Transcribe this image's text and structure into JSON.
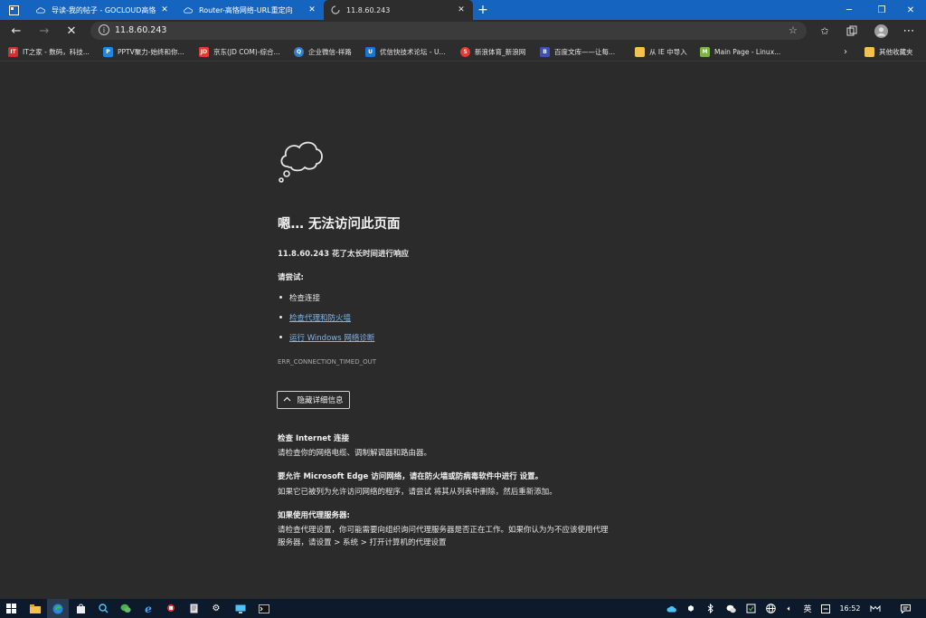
{
  "tabs": [
    {
      "label": "导读-我的帖子 - GOCLOUD高恪",
      "icon": "cloud-icon"
    },
    {
      "label": "Router-高恪网络-URL重定向",
      "icon": "cloud-icon"
    },
    {
      "label": "11.8.60.243",
      "icon": "loading-spinner-icon"
    }
  ],
  "new_tab_label": "+",
  "address": {
    "url": "11.8.60.243"
  },
  "bookmarks": [
    {
      "label": "IT之家 - 数码，科技...",
      "icon": "IT",
      "color": "#d32f2f"
    },
    {
      "label": "PPTV聚力-始终和你...",
      "icon": "P",
      "color": "#1e88e5"
    },
    {
      "label": "京东(JD COM)-综合...",
      "icon": "JD",
      "color": "#e53935"
    },
    {
      "label": "企业微信-祥路",
      "icon": "Q",
      "color": "#2e7dd1"
    },
    {
      "label": "优信快技术论坛 - U...",
      "icon": "U",
      "color": "#1976d2"
    },
    {
      "label": "新浪体育_新浪网",
      "icon": "S",
      "color": "#e53935"
    },
    {
      "label": "百度文库——让每...",
      "icon": "B",
      "color": "#3f51b5"
    },
    {
      "label": "从 IE 中导入",
      "icon": "folder",
      "color": "#f2c14e"
    },
    {
      "label": "Main Page - Linux...",
      "icon": "M",
      "color": "#7cb342"
    },
    {
      "label": "其他收藏夹",
      "icon": "folder",
      "color": "#f2c14e"
    }
  ],
  "error": {
    "title": "嗯… 无法访问此页面",
    "host_line": "11.8.60.243 花了太长时间进行响应",
    "try_label": "请尝试:",
    "suggestions": [
      {
        "text": "检查连接",
        "link": false
      },
      {
        "text": "检查代理和防火墙",
        "link": true
      },
      {
        "text": "运行 Windows 网络诊断",
        "link": true
      }
    ],
    "code": "ERR_CONNECTION_TIMED_OUT",
    "details_button": "隐藏详细信息",
    "sections": [
      {
        "title": "检查 Internet 连接",
        "lines": [
          "请检查你的网络电缆、调制解调器和路由器。"
        ]
      },
      {
        "title": "要允许 Microsoft Edge 访问网络，请在防火墙或防病毒软件中进行 设置。",
        "lines": [
          "如果它已被列为允许访问网络的程序，请尝试 将其从列表中删除，然后重新添加。"
        ]
      },
      {
        "title": "如果使用代理服务器:",
        "lines": [
          "请检查代理设置，你可能需要向组织询问代理服务器是否正在工作。如果你认为为不应该使用代理",
          "服务器，请设置 > 系统 > 打开计算机的代理设置"
        ]
      }
    ]
  },
  "taskbar": {
    "ime": "英",
    "clock": "16:52"
  }
}
